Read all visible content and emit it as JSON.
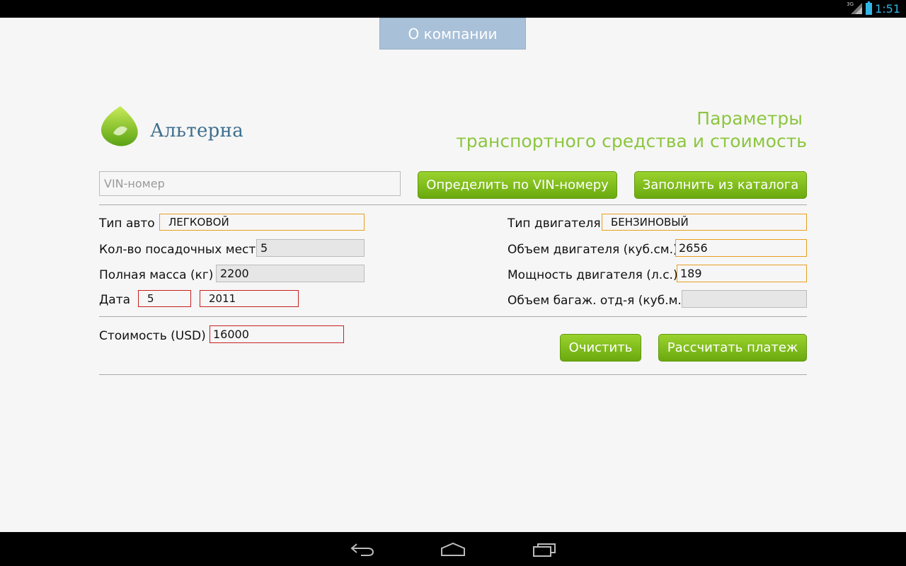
{
  "status_bar": {
    "network": "3G",
    "time": "1:51",
    "icons": [
      "signal-icon",
      "battery-icon"
    ]
  },
  "header": {
    "company_button": "О компании"
  },
  "brand": {
    "name": "Альтерна",
    "logo_icon": "leaf-drop-logo"
  },
  "title": {
    "line1": "Параметры",
    "line2": "транспортного средства и стоимость"
  },
  "vin": {
    "placeholder": "VIN-номер",
    "value": "",
    "detect_button": "Определить по VIN-номеру",
    "catalog_button": "Заполнить из каталога"
  },
  "left": {
    "car_type_label": "Тип авто",
    "car_type_value": "ЛЕГКОВОЙ",
    "seats_label": "Кол-во посадочных мест",
    "seats_value": "5",
    "mass_label": "Полная масса (кг)",
    "mass_value": "2200",
    "date_label": "Дата",
    "date_month": "5",
    "date_year": "2011"
  },
  "right": {
    "engine_type_label": "Тип двигателя",
    "engine_type_value": "БЕНЗИНОВЫЙ",
    "engine_volume_label": "Объем двигателя (куб.см.)",
    "engine_volume_value": "2656",
    "power_label": "Мощность двигателя (л.с.)",
    "power_value": "189",
    "trunk_label": "Объем багаж. отд-я (куб.м.)",
    "trunk_value": ""
  },
  "cost": {
    "label": "Стоимость (USD)",
    "value": "16000"
  },
  "actions": {
    "clear_button": "Очистить",
    "calculate_button": "Рассчитать платеж"
  },
  "nav": {
    "icons": [
      "back-icon",
      "home-icon",
      "recents-icon"
    ]
  },
  "colors": {
    "accent_green": "#8cc63f",
    "button_green": "#7cbf1a",
    "company_button": "#a8c0d8",
    "brand_blue": "#3d6f8e",
    "status_clock": "#33b5e5",
    "error_border": "#c82020",
    "field_border": "#e8a020"
  }
}
